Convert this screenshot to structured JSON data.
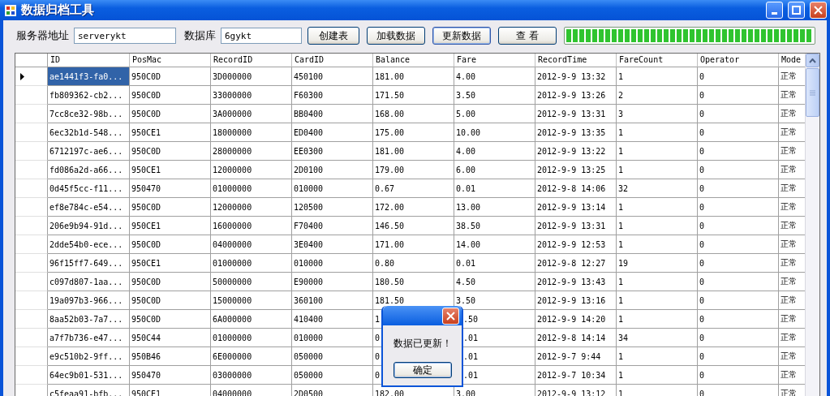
{
  "window": {
    "title": "数据归档工具"
  },
  "toolbar": {
    "server_label": "服务器地址",
    "server_value": "serverykt",
    "db_label": "数据库",
    "db_value": "6gykt",
    "buttons": [
      {
        "label": "创建表",
        "focused": false
      },
      {
        "label": "加载数据",
        "focused": false
      },
      {
        "label": "更新数据",
        "focused": true
      },
      {
        "label": "查 看",
        "focused": false
      }
    ],
    "progress": {
      "level": 1
    }
  },
  "table": {
    "columns": [
      "ID",
      "PosMac",
      "RecordID",
      "CardID",
      "Balance",
      "Fare",
      "RecordTime",
      "FareCount",
      "Operator",
      "Mode"
    ],
    "rows": [
      {
        "selected": true,
        "cells": [
          "ae1441f3-fa0...",
          "950C0D",
          "3D000000",
          "450100",
          "181.00",
          "4.00",
          "2012-9-9 13:32",
          "1",
          "0",
          "正常"
        ]
      },
      {
        "selected": false,
        "cells": [
          "fb809362-cb2...",
          "950C0D",
          "33000000",
          "F60300",
          "171.50",
          "3.50",
          "2012-9-9 13:26",
          "2",
          "0",
          "正常"
        ]
      },
      {
        "selected": false,
        "cells": [
          "7cc8ce32-98b...",
          "950C0D",
          "3A000000",
          "BB0400",
          "168.00",
          "5.00",
          "2012-9-9 13:31",
          "3",
          "0",
          "正常"
        ]
      },
      {
        "selected": false,
        "cells": [
          "6ec32b1d-548...",
          "950CE1",
          "18000000",
          "ED0400",
          "175.00",
          "10.00",
          "2012-9-9 13:35",
          "1",
          "0",
          "正常"
        ]
      },
      {
        "selected": false,
        "cells": [
          "6712197c-ae6...",
          "950C0D",
          "28000000",
          "EE0300",
          "181.00",
          "4.00",
          "2012-9-9 13:22",
          "1",
          "0",
          "正常"
        ]
      },
      {
        "selected": false,
        "cells": [
          "fd086a2d-a66...",
          "950CE1",
          "12000000",
          "2D0100",
          "179.00",
          "6.00",
          "2012-9-9 13:25",
          "1",
          "0",
          "正常"
        ]
      },
      {
        "selected": false,
        "cells": [
          "0d45f5cc-f11...",
          "950470",
          "01000000",
          "010000",
          "0.67",
          "0.01",
          "2012-9-8 14:06",
          "32",
          "0",
          "正常"
        ]
      },
      {
        "selected": false,
        "cells": [
          "ef8e784c-e54...",
          "950C0D",
          "12000000",
          "120500",
          "172.00",
          "13.00",
          "2012-9-9 13:14",
          "1",
          "0",
          "正常"
        ]
      },
      {
        "selected": false,
        "cells": [
          "206e9b94-91d...",
          "950CE1",
          "16000000",
          "F70400",
          "146.50",
          "38.50",
          "2012-9-9 13:31",
          "1",
          "0",
          "正常"
        ]
      },
      {
        "selected": false,
        "cells": [
          "2dde54b0-ece...",
          "950C0D",
          "04000000",
          "3E0400",
          "171.00",
          "14.00",
          "2012-9-9 12:53",
          "1",
          "0",
          "正常"
        ]
      },
      {
        "selected": false,
        "cells": [
          "96f15ff7-649...",
          "950CE1",
          "01000000",
          "010000",
          "0.80",
          "0.01",
          "2012-9-8 12:27",
          "19",
          "0",
          "正常"
        ]
      },
      {
        "selected": false,
        "cells": [
          "c097d807-1aa...",
          "950C0D",
          "50000000",
          "E90000",
          "180.50",
          "4.50",
          "2012-9-9 13:43",
          "1",
          "0",
          "正常"
        ]
      },
      {
        "selected": false,
        "cells": [
          "19a097b3-966...",
          "950C0D",
          "15000000",
          "360100",
          "181.50",
          "3.50",
          "2012-9-9 13:16",
          "1",
          "0",
          "正常"
        ]
      },
      {
        "selected": false,
        "under_dialog": true,
        "cells": [
          "8aa52b03-7a7...",
          "950C0D",
          "6A000000",
          "410400",
          "1",
          ".50",
          "2012-9-9 14:20",
          "1",
          "0",
          "正常"
        ]
      },
      {
        "selected": false,
        "under_dialog": true,
        "cells": [
          "a7f7b736-e47...",
          "950C44",
          "01000000",
          "010000",
          "0",
          ".01",
          "2012-9-8 14:14",
          "34",
          "0",
          "正常"
        ]
      },
      {
        "selected": false,
        "under_dialog": true,
        "cells": [
          "e9c510b2-9ff...",
          "950B46",
          "6E000000",
          "050000",
          "0",
          ".01",
          "2012-9-7 9:44",
          "1",
          "0",
          "正常"
        ]
      },
      {
        "selected": false,
        "under_dialog": true,
        "cells": [
          "64ec9b01-531...",
          "950470",
          "03000000",
          "050000",
          "0",
          ".01",
          "2012-9-7 10:34",
          "1",
          "0",
          "正常"
        ]
      },
      {
        "selected": false,
        "cells": [
          "c5feaa91-bfb...",
          "950CE1",
          "04000000",
          "2D0500",
          "182.00",
          "3.00",
          "2012-9-9 13:12",
          "1",
          "0",
          "正常"
        ]
      }
    ]
  },
  "dialog": {
    "message": "数据已更新！",
    "button": "确定"
  }
}
